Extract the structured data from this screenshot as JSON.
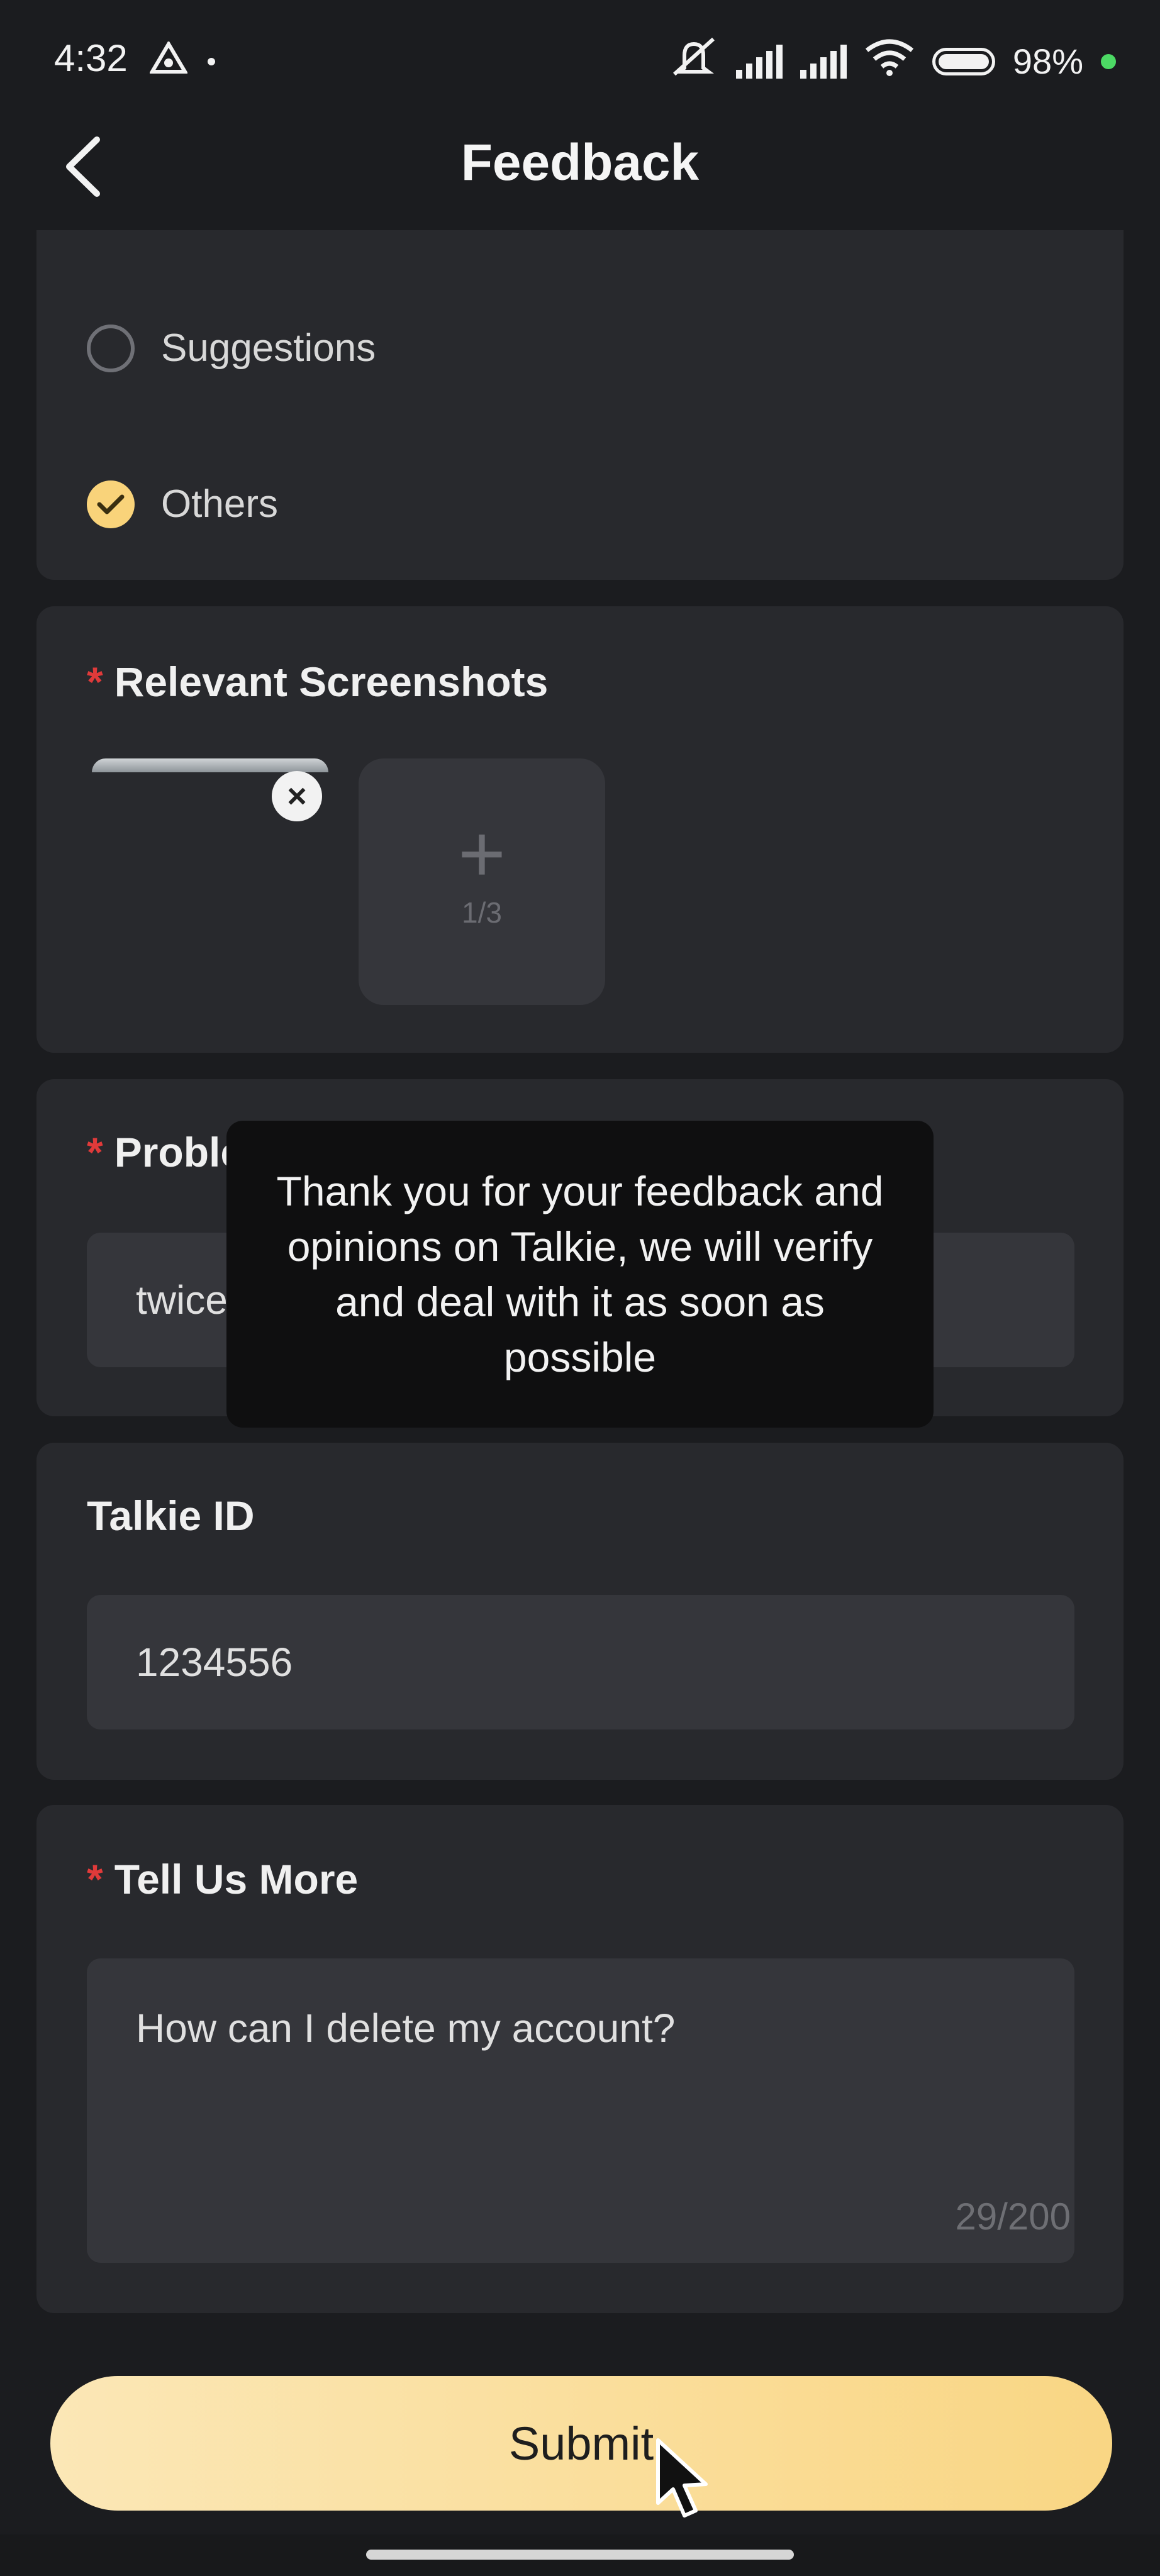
{
  "status_bar": {
    "time": "4:32",
    "battery": "98%"
  },
  "header": {
    "title": "Feedback"
  },
  "feedback_type": {
    "options": [
      {
        "label": "Suggestions",
        "selected": false
      },
      {
        "label": "Others",
        "selected": true
      }
    ]
  },
  "screenshots": {
    "required_mark": "*",
    "title": "Relevant Screenshots",
    "count": "1/3"
  },
  "problem_time": {
    "required_mark": "*",
    "title": "Problem occurred time",
    "value": "twice"
  },
  "talkie_id": {
    "title": "Talkie ID",
    "value": "1234556"
  },
  "tell_more": {
    "required_mark": "*",
    "title": "Tell Us More",
    "value": "How can I delete my account?",
    "counter": "29/200"
  },
  "toast": {
    "message": "Thank you for your feedback and opinions on Talkie, we will verify and deal with it as soon as possible"
  },
  "submit": {
    "label": "Submit"
  },
  "colors": {
    "accent": "#f9d37a",
    "background": "#1b1c1f",
    "card": "#28292d",
    "required": "#e03a3a"
  }
}
